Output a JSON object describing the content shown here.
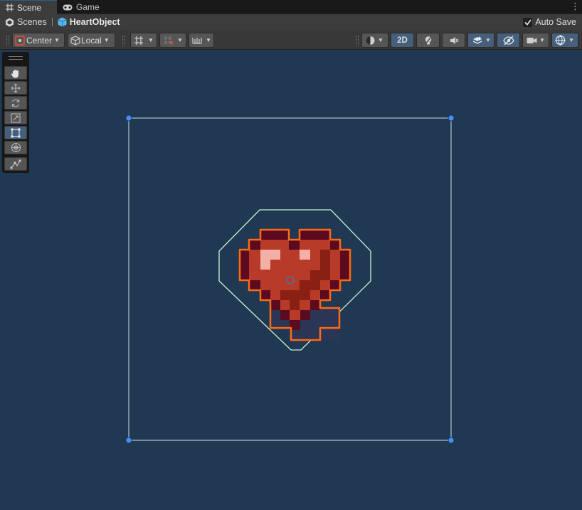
{
  "tabs": [
    {
      "label": "Scene",
      "icon": "hash-grid-icon",
      "active": true
    },
    {
      "label": "Game",
      "icon": "gamepad-icon",
      "active": false
    }
  ],
  "breadcrumb": {
    "root": "Scenes",
    "object": "HeartObject"
  },
  "autosave": {
    "label": "Auto Save",
    "checked": true
  },
  "toolbar": {
    "pivot_label": "Center",
    "space_label": "Local",
    "mode_2d_label": "2D",
    "mode_2d_active": true
  },
  "tool_palette": {
    "tools": [
      "hand-tool",
      "move-tool",
      "rotate-tool",
      "scale-tool",
      "rect-tool",
      "transform-tool",
      "custom-tool"
    ],
    "selected": "rect-tool"
  },
  "colors": {
    "scene_bg": "#203851",
    "selection_outline": "#ff6a14",
    "handle": "#4a8ef0",
    "collider": "#b9f0d0"
  }
}
